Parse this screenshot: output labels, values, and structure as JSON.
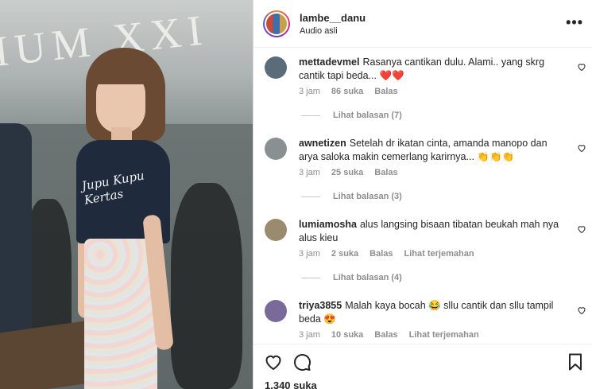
{
  "post": {
    "username": "lambe__danu",
    "audio": "Audio asli",
    "more_label": "•••",
    "likes": "1.340 suka"
  },
  "media": {
    "screen_text": "IUM XXI",
    "shirt_text": "Jupu Kupu Kertas"
  },
  "comments": [
    {
      "user": "mettadevmel",
      "text": "Rasanya cantikan dulu. Alami.. yang skrg cantik tapi beda... ❤️❤️",
      "time": "3 jam",
      "likes": "86 suka",
      "reply": "Balas",
      "translate": "",
      "view_replies": "Lihat balasan (7)",
      "avatar_color": "#5a6b7a"
    },
    {
      "user": "awnetizen",
      "text": "Setelah dr ikatan cinta, amanda manopo dan arya saloka makin cemerlang karirnya... 👏👏👏",
      "time": "3 jam",
      "likes": "25 suka",
      "reply": "Balas",
      "translate": "",
      "view_replies": "Lihat balasan (3)",
      "avatar_color": "#8a8f92"
    },
    {
      "user": "lumiamosha",
      "text": "alus langsing bisaan tibatan beukah mah nya alus kieu",
      "time": "3 jam",
      "likes": "2 suka",
      "reply": "Balas",
      "translate": "Lihat terjemahan",
      "view_replies": "Lihat balasan (4)",
      "avatar_color": "#9a8a6e"
    },
    {
      "user": "triya3855",
      "text": "Malah kaya bocah 😂 sllu cantik dan sllu tampil beda 😍",
      "time": "3 jam",
      "likes": "10 suka",
      "reply": "Balas",
      "translate": "Lihat terjemahan",
      "view_replies": "",
      "avatar_color": "#7a6a9a"
    }
  ],
  "icons": {
    "like": "heart-icon",
    "comment": "comment-icon",
    "save": "bookmark-icon",
    "comment_like": "heart-outline-icon"
  }
}
